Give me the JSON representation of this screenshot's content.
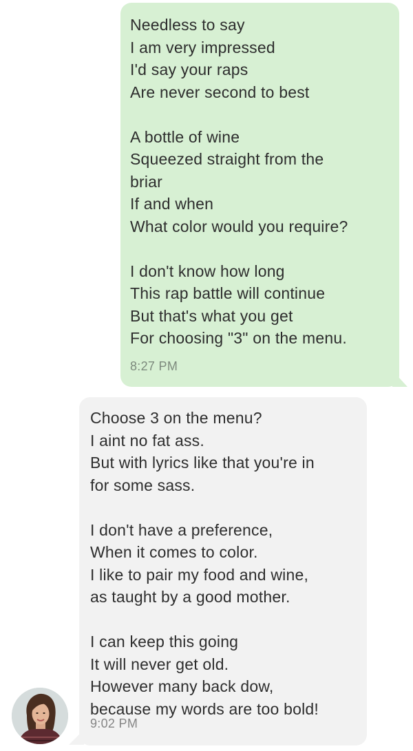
{
  "thread": {
    "messages": [
      {
        "direction": "sent",
        "lines": [
          "Needless to say",
          "I am very impressed",
          "I'd say your raps",
          "Are never second to best",
          "",
          "A bottle of wine",
          "Squeezed straight from the",
          "briar",
          "If and when",
          "What color would you require?",
          "",
          "I don't know how long",
          "This rap battle will continue",
          "But that's what you get",
          "For choosing \"3\" on the menu."
        ],
        "time": "8:27 PM"
      },
      {
        "direction": "received",
        "lines": [
          "Choose 3 on the menu?",
          "I aint no fat ass.",
          "But with lyrics like that you're in",
          "for some sass.",
          "",
          "I don't have a preference,",
          "When it comes to color.",
          "I like to pair my food and wine,",
          "as taught by a good mother.",
          "",
          "I can keep this going",
          "It will never get old.",
          "However many back dow,",
          "because my words are too bold!"
        ],
        "time": "9:02 PM"
      }
    ]
  },
  "colors": {
    "sent_bubble": "#d7f0d3",
    "received_bubble": "#f2f2f2",
    "text": "#2d2d2d",
    "timestamp": "#7d8a7d"
  },
  "icons": {
    "avatar": "contact-avatar"
  }
}
